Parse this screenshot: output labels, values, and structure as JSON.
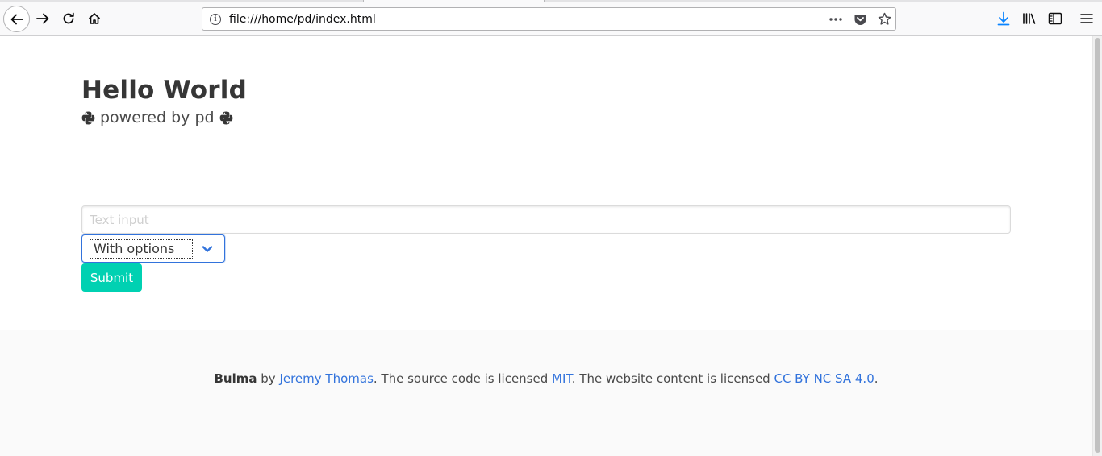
{
  "browser": {
    "url": "file:///home/pd/index.html"
  },
  "hero": {
    "title": "Hello World",
    "subtitle": "powered by pd"
  },
  "form": {
    "text_placeholder": "Text input",
    "select_value": "With options",
    "submit_label": "Submit"
  },
  "footer": {
    "brand": "Bulma",
    "by": " by ",
    "author": "Jeremy Thomas",
    "source_text": ". The source code is licensed ",
    "source_license": "MIT",
    "content_text": ". The website content is licensed ",
    "content_license": "CC BY NC SA 4.0",
    "end": "."
  },
  "colors": {
    "primary": "#00d1b2",
    "link": "#3273dc",
    "footer_bg": "#fafafa"
  },
  "icons": {
    "hero_left": "python-icon",
    "hero_right": "python-icon"
  }
}
